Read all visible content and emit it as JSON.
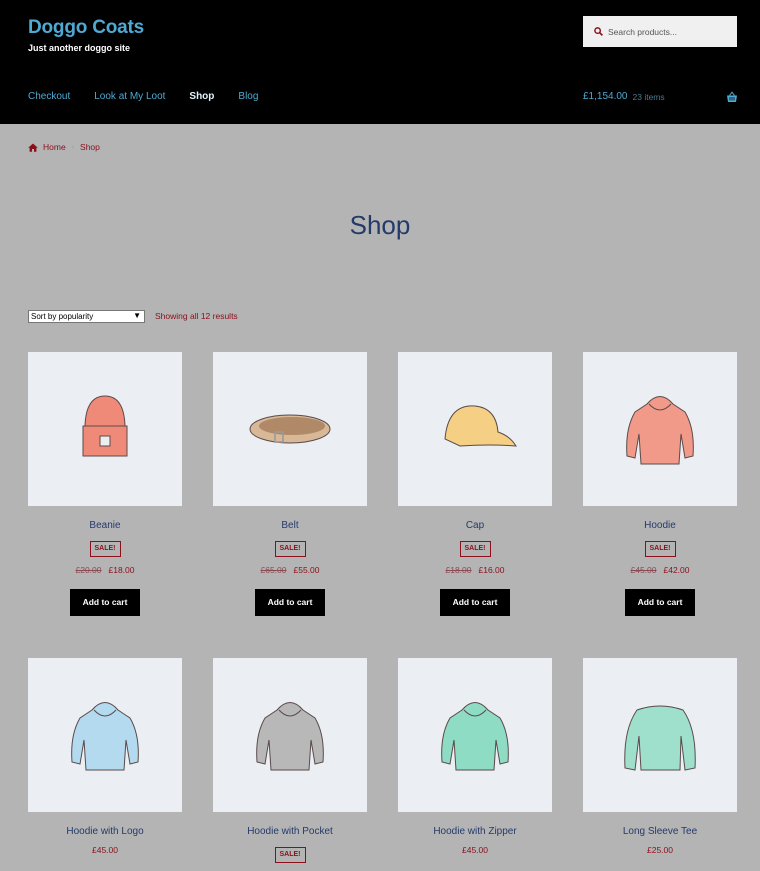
{
  "header": {
    "site_title": "Doggo Coats",
    "tagline": "Just another doggo site",
    "search_placeholder": "Search products...",
    "nav": [
      {
        "label": "Checkout",
        "active": false
      },
      {
        "label": "Look at My Loot",
        "active": false
      },
      {
        "label": "Shop",
        "active": true
      },
      {
        "label": "Blog",
        "active": false
      }
    ],
    "cart": {
      "amount": "£1,154.00",
      "count": "23 items"
    }
  },
  "breadcrumb": {
    "home": "Home",
    "current": "Shop"
  },
  "page_title": "Shop",
  "toolbar": {
    "sort_selected": "Sort by popularity",
    "result_count": "Showing all 12 results"
  },
  "products": [
    {
      "name": "Beanie",
      "sale": true,
      "sale_label": "SALE!",
      "old_price": "£20.00",
      "price": "£18.00",
      "button": "Add to cart",
      "color": "#f08a78",
      "kind": "beanie"
    },
    {
      "name": "Belt",
      "sale": true,
      "sale_label": "SALE!",
      "old_price": "£65.00",
      "price": "£55.00",
      "button": "Add to cart",
      "color": "#d8b896",
      "kind": "belt"
    },
    {
      "name": "Cap",
      "sale": true,
      "sale_label": "SALE!",
      "old_price": "£18.00",
      "price": "£16.00",
      "button": "Add to cart",
      "color": "#f4cf84",
      "kind": "cap"
    },
    {
      "name": "Hoodie",
      "sale": true,
      "sale_label": "SALE!",
      "old_price": "£45.00",
      "price": "£42.00",
      "button": "Add to cart",
      "color": "#f29a8a",
      "kind": "hoodie"
    },
    {
      "name": "Hoodie with Logo",
      "sale": false,
      "price": "£45.00",
      "color": "#b4daf0",
      "kind": "hoodie"
    },
    {
      "name": "Hoodie with Pocket",
      "sale": true,
      "sale_label": "SALE!",
      "color": "#b8b8b8",
      "kind": "hoodie"
    },
    {
      "name": "Hoodie with Zipper",
      "sale": false,
      "price": "£45.00",
      "color": "#8fdcc4",
      "kind": "hoodie"
    },
    {
      "name": "Long Sleeve Tee",
      "sale": false,
      "price": "£25.00",
      "color": "#9ee0cc",
      "kind": "tee"
    }
  ]
}
